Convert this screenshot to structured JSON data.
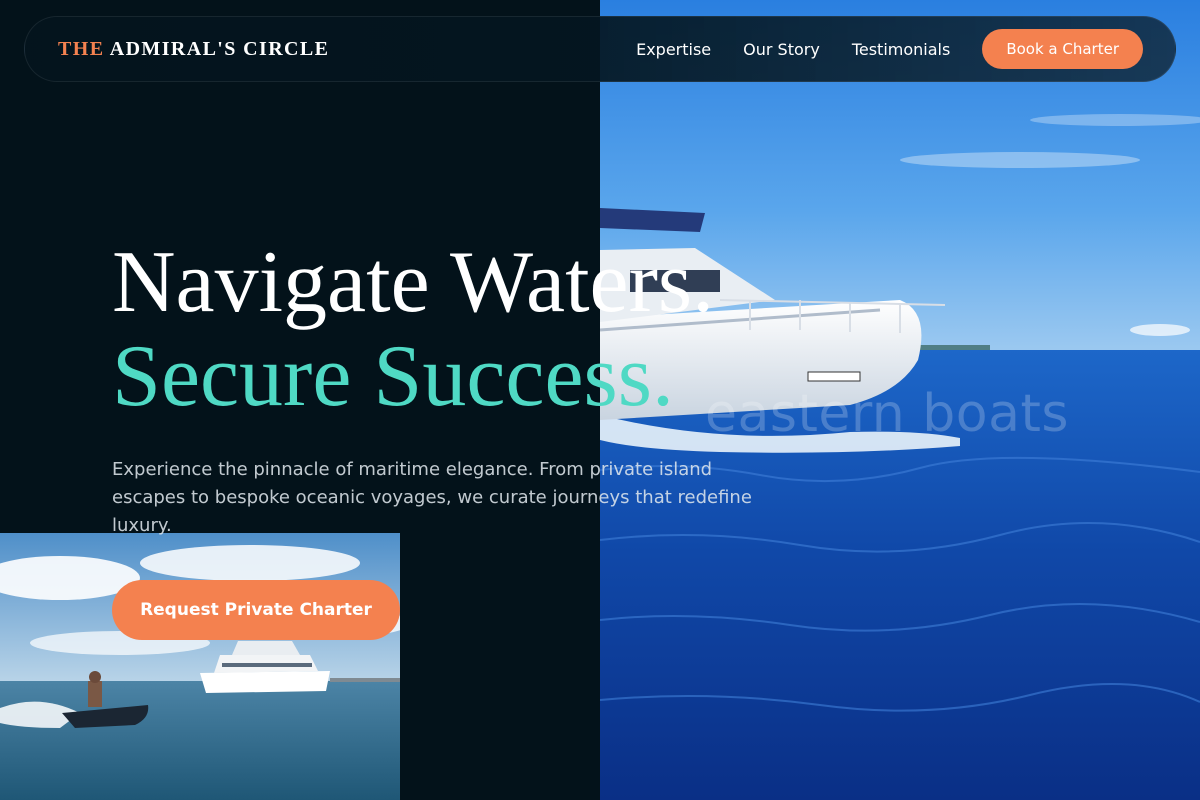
{
  "brand": {
    "prefix": "THE",
    "name": "ADMIRAL'S CIRCLE"
  },
  "nav": {
    "links": [
      "Expertise",
      "Our Story",
      "Testimonials"
    ],
    "cta_label": "Book a Charter"
  },
  "hero": {
    "headline_line1": "Navigate Waters.",
    "headline_line2": "Secure Success.",
    "description": "Experience the pinnacle of maritime elegance. From private island escapes to bespoke oceanic voyages, we curate journeys that redefine luxury.",
    "cta_label": "Request Private Charter",
    "photo_watermark": "eastern boats"
  },
  "colors": {
    "background": "#03121a",
    "accent_orange": "#f4814f",
    "accent_teal": "#4fd9c4"
  }
}
